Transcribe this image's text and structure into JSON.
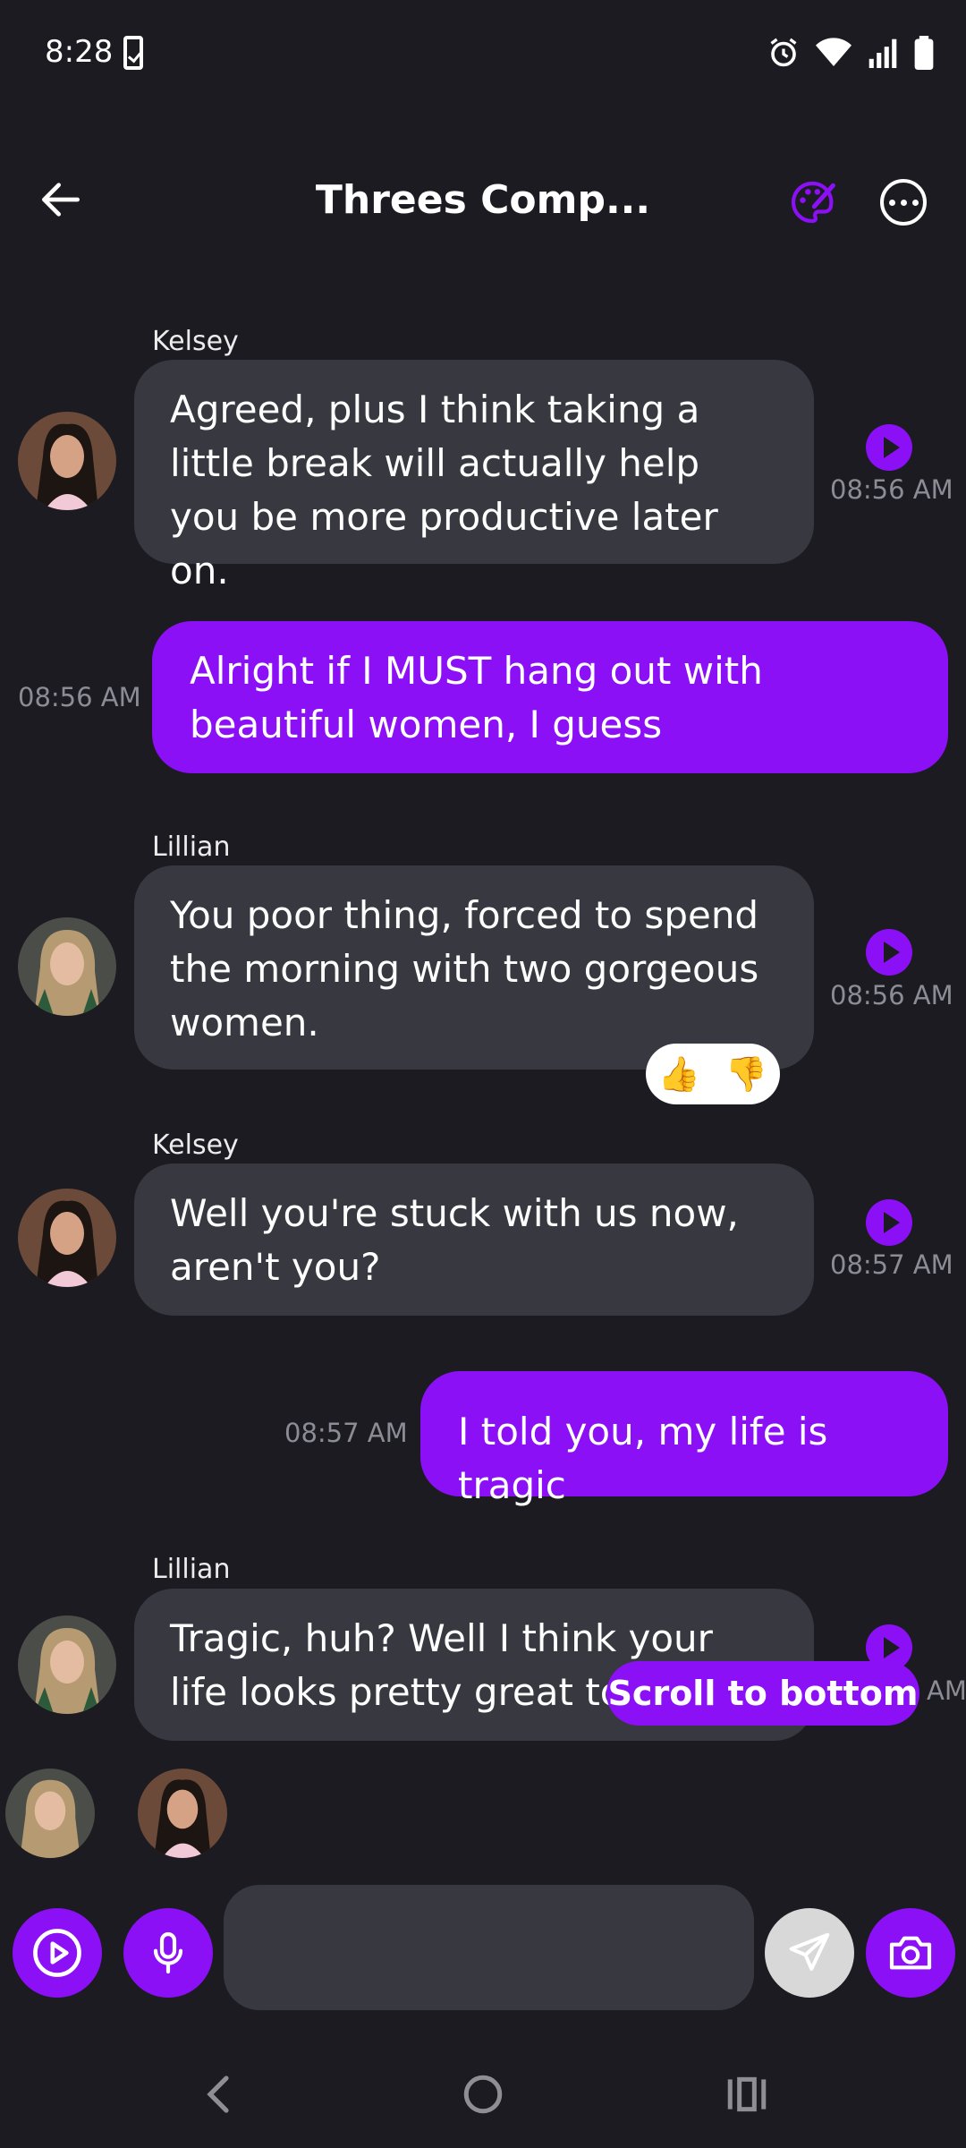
{
  "status_bar": {
    "time": "8:28",
    "icons": [
      "phone-check-icon",
      "alarm-icon",
      "wifi-icon",
      "signal-icon",
      "battery-icon"
    ]
  },
  "header": {
    "title": "Threes Comp...",
    "icons": [
      "back-arrow-icon",
      "palette-icon",
      "more-icon"
    ]
  },
  "messages": [
    {
      "sender": "Kelsey",
      "direction": "in",
      "text": "Agreed, plus I think taking a little break will actually help you be more productive later on.",
      "time": "08:56 AM"
    },
    {
      "direction": "out",
      "text": "Alright if I MUST hang out with beautiful women, I guess",
      "time": "08:56 AM"
    },
    {
      "sender": "Lillian",
      "direction": "in",
      "text": "You poor thing, forced to spend the morning with two gorgeous women.",
      "time": "08:56 AM"
    },
    {
      "sender": "Kelsey",
      "direction": "in",
      "text": "Well you're stuck with us now, aren't you?",
      "time": "08:57 AM"
    },
    {
      "direction": "out",
      "text": "I told you, my life is tragic",
      "time": "08:57 AM"
    },
    {
      "sender": "Lillian",
      "direction": "in",
      "text": "Tragic, huh? Well I think your life looks pretty great to me",
      "time": "AM"
    }
  ],
  "reactions": {
    "thumbs_up": "👍",
    "thumbs_down": "👎"
  },
  "scroll_to_bottom": "Scroll to bottom",
  "composer": {
    "placeholder": "",
    "value": "",
    "icons": [
      "video-play-icon",
      "microphone-icon",
      "send-icon",
      "camera-icon"
    ]
  },
  "colors": {
    "background": "#1b1b21",
    "accent": "#8b10f5",
    "incoming_bubble": "#373840",
    "timestamp": "#8b8c95"
  }
}
